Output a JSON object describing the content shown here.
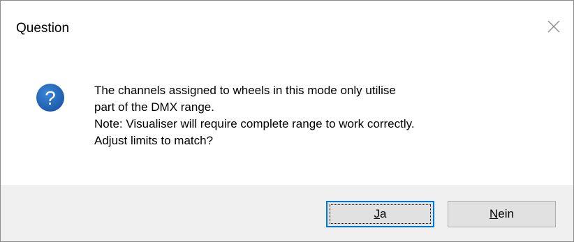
{
  "window": {
    "title": "Question",
    "close_icon": "close-icon"
  },
  "message": {
    "icon": "question-icon",
    "icon_color": "#1f62b8",
    "lines": [
      "The channels assigned to wheels in this mode only utilise",
      "part of the DMX range.",
      "Note: Visualiser will require complete range to work correctly.",
      "Adjust limits to match?"
    ]
  },
  "buttons": {
    "yes": {
      "label": "Ja",
      "mnemonic": "J",
      "rest": "a"
    },
    "no": {
      "label": "Nein",
      "mnemonic": "N",
      "rest": "ein"
    }
  },
  "colors": {
    "footer": "#f0f0f0",
    "focus_border": "#0078d7",
    "button_face": "#e1e1e1"
  }
}
